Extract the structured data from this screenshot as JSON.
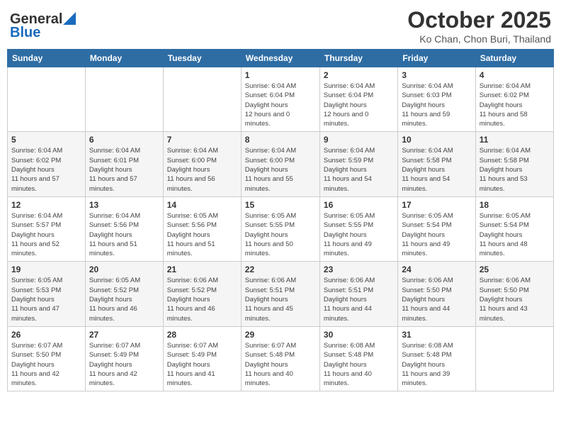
{
  "header": {
    "logo_general": "General",
    "logo_blue": "Blue",
    "month": "October 2025",
    "location": "Ko Chan, Chon Buri, Thailand"
  },
  "weekdays": [
    "Sunday",
    "Monday",
    "Tuesday",
    "Wednesday",
    "Thursday",
    "Friday",
    "Saturday"
  ],
  "weeks": [
    [
      {
        "day": "",
        "sunrise": "",
        "sunset": "",
        "daylight": ""
      },
      {
        "day": "",
        "sunrise": "",
        "sunset": "",
        "daylight": ""
      },
      {
        "day": "",
        "sunrise": "",
        "sunset": "",
        "daylight": ""
      },
      {
        "day": "1",
        "sunrise": "6:04 AM",
        "sunset": "6:04 PM",
        "daylight": "12 hours and 0 minutes."
      },
      {
        "day": "2",
        "sunrise": "6:04 AM",
        "sunset": "6:04 PM",
        "daylight": "12 hours and 0 minutes."
      },
      {
        "day": "3",
        "sunrise": "6:04 AM",
        "sunset": "6:03 PM",
        "daylight": "11 hours and 59 minutes."
      },
      {
        "day": "4",
        "sunrise": "6:04 AM",
        "sunset": "6:02 PM",
        "daylight": "11 hours and 58 minutes."
      }
    ],
    [
      {
        "day": "5",
        "sunrise": "6:04 AM",
        "sunset": "6:02 PM",
        "daylight": "11 hours and 57 minutes."
      },
      {
        "day": "6",
        "sunrise": "6:04 AM",
        "sunset": "6:01 PM",
        "daylight": "11 hours and 57 minutes."
      },
      {
        "day": "7",
        "sunrise": "6:04 AM",
        "sunset": "6:00 PM",
        "daylight": "11 hours and 56 minutes."
      },
      {
        "day": "8",
        "sunrise": "6:04 AM",
        "sunset": "6:00 PM",
        "daylight": "11 hours and 55 minutes."
      },
      {
        "day": "9",
        "sunrise": "6:04 AM",
        "sunset": "5:59 PM",
        "daylight": "11 hours and 54 minutes."
      },
      {
        "day": "10",
        "sunrise": "6:04 AM",
        "sunset": "5:58 PM",
        "daylight": "11 hours and 54 minutes."
      },
      {
        "day": "11",
        "sunrise": "6:04 AM",
        "sunset": "5:58 PM",
        "daylight": "11 hours and 53 minutes."
      }
    ],
    [
      {
        "day": "12",
        "sunrise": "6:04 AM",
        "sunset": "5:57 PM",
        "daylight": "11 hours and 52 minutes."
      },
      {
        "day": "13",
        "sunrise": "6:04 AM",
        "sunset": "5:56 PM",
        "daylight": "11 hours and 51 minutes."
      },
      {
        "day": "14",
        "sunrise": "6:05 AM",
        "sunset": "5:56 PM",
        "daylight": "11 hours and 51 minutes."
      },
      {
        "day": "15",
        "sunrise": "6:05 AM",
        "sunset": "5:55 PM",
        "daylight": "11 hours and 50 minutes."
      },
      {
        "day": "16",
        "sunrise": "6:05 AM",
        "sunset": "5:55 PM",
        "daylight": "11 hours and 49 minutes."
      },
      {
        "day": "17",
        "sunrise": "6:05 AM",
        "sunset": "5:54 PM",
        "daylight": "11 hours and 49 minutes."
      },
      {
        "day": "18",
        "sunrise": "6:05 AM",
        "sunset": "5:54 PM",
        "daylight": "11 hours and 48 minutes."
      }
    ],
    [
      {
        "day": "19",
        "sunrise": "6:05 AM",
        "sunset": "5:53 PM",
        "daylight": "11 hours and 47 minutes."
      },
      {
        "day": "20",
        "sunrise": "6:05 AM",
        "sunset": "5:52 PM",
        "daylight": "11 hours and 46 minutes."
      },
      {
        "day": "21",
        "sunrise": "6:06 AM",
        "sunset": "5:52 PM",
        "daylight": "11 hours and 46 minutes."
      },
      {
        "day": "22",
        "sunrise": "6:06 AM",
        "sunset": "5:51 PM",
        "daylight": "11 hours and 45 minutes."
      },
      {
        "day": "23",
        "sunrise": "6:06 AM",
        "sunset": "5:51 PM",
        "daylight": "11 hours and 44 minutes."
      },
      {
        "day": "24",
        "sunrise": "6:06 AM",
        "sunset": "5:50 PM",
        "daylight": "11 hours and 44 minutes."
      },
      {
        "day": "25",
        "sunrise": "6:06 AM",
        "sunset": "5:50 PM",
        "daylight": "11 hours and 43 minutes."
      }
    ],
    [
      {
        "day": "26",
        "sunrise": "6:07 AM",
        "sunset": "5:50 PM",
        "daylight": "11 hours and 42 minutes."
      },
      {
        "day": "27",
        "sunrise": "6:07 AM",
        "sunset": "5:49 PM",
        "daylight": "11 hours and 42 minutes."
      },
      {
        "day": "28",
        "sunrise": "6:07 AM",
        "sunset": "5:49 PM",
        "daylight": "11 hours and 41 minutes."
      },
      {
        "day": "29",
        "sunrise": "6:07 AM",
        "sunset": "5:48 PM",
        "daylight": "11 hours and 40 minutes."
      },
      {
        "day": "30",
        "sunrise": "6:08 AM",
        "sunset": "5:48 PM",
        "daylight": "11 hours and 40 minutes."
      },
      {
        "day": "31",
        "sunrise": "6:08 AM",
        "sunset": "5:48 PM",
        "daylight": "11 hours and 39 minutes."
      },
      {
        "day": "",
        "sunrise": "",
        "sunset": "",
        "daylight": ""
      }
    ]
  ],
  "labels": {
    "sunrise": "Sunrise:",
    "sunset": "Sunset:",
    "daylight": "Daylight hours"
  }
}
